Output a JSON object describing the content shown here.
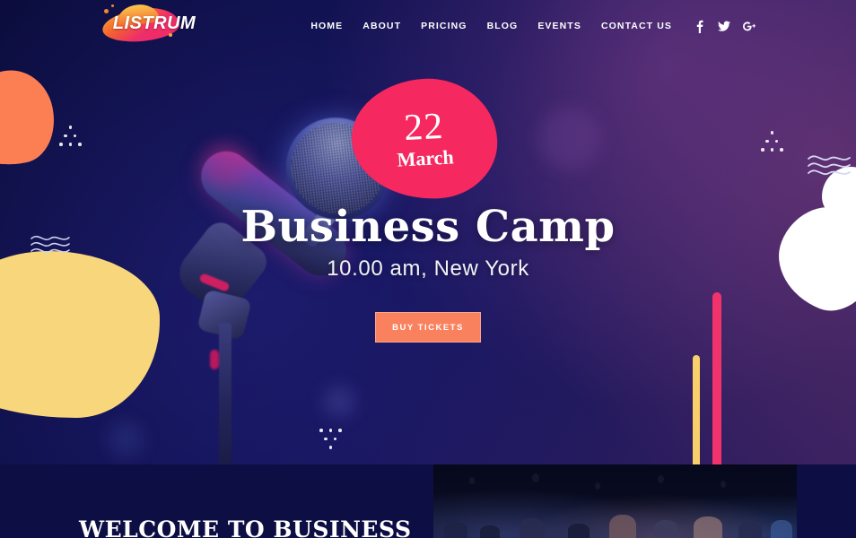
{
  "header": {
    "logo_text": "LISTRUM",
    "nav_items": [
      {
        "label": "HOME"
      },
      {
        "label": "ABOUT"
      },
      {
        "label": "PRICING"
      },
      {
        "label": "BLOG"
      },
      {
        "label": "EVENTS"
      },
      {
        "label": "CONTACT US"
      }
    ],
    "social": [
      {
        "name": "facebook-icon",
        "label": "f"
      },
      {
        "name": "twitter-icon",
        "label": "t"
      },
      {
        "name": "google-plus-icon",
        "label": "G+"
      }
    ]
  },
  "hero": {
    "date_badge": {
      "day": "22",
      "month": "March"
    },
    "title": "Business Camp",
    "subtitle": "10.00 am, New York",
    "cta_label": "BUY TICKETS"
  },
  "lower": {
    "welcome_title": "WELCOME TO BUSINESS"
  },
  "colors": {
    "background_navy": "#0d0e43",
    "accent_pink": "#f5285f",
    "accent_orange": "#fc7f54",
    "accent_yellow": "#f8d77c",
    "cta_orange": "#f9815e",
    "bar_pink": "#f0336c",
    "bar_yellow": "#f9cf6a",
    "text_white": "#ffffff"
  }
}
